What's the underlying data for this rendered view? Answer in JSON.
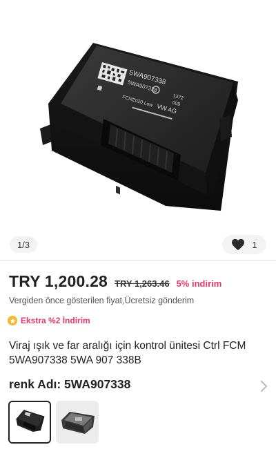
{
  "gallery": {
    "page_indicator": "1/3",
    "like_count": "1",
    "label_lines": [
      "5WA907338",
      "5WA907338",
      "1372",
      "009",
      "VW AG",
      "FCM2020 Low"
    ]
  },
  "pricing": {
    "price": "TRY 1,200.28",
    "old_price": "TRY 1,263.46",
    "discount": "5% indirim",
    "subtitle": "Vergiden önce gösterilen fiyat,Ücretsiz gönderim",
    "promo": "Ekstra %2 İndirim"
  },
  "product": {
    "title": "Viraj ışık ve far aralığı için kontrol ünitesi Ctrl FCM 5WA907338 5WA 907 338B"
  },
  "variant": {
    "label": "renk Adı: 5WA907338"
  },
  "colors": {
    "accent_pink": "#e5396f",
    "promo_gold": "#f5b82e",
    "text_dark": "#222222"
  },
  "icons": [
    "heart-icon",
    "star-icon",
    "chevron-right-icon"
  ]
}
